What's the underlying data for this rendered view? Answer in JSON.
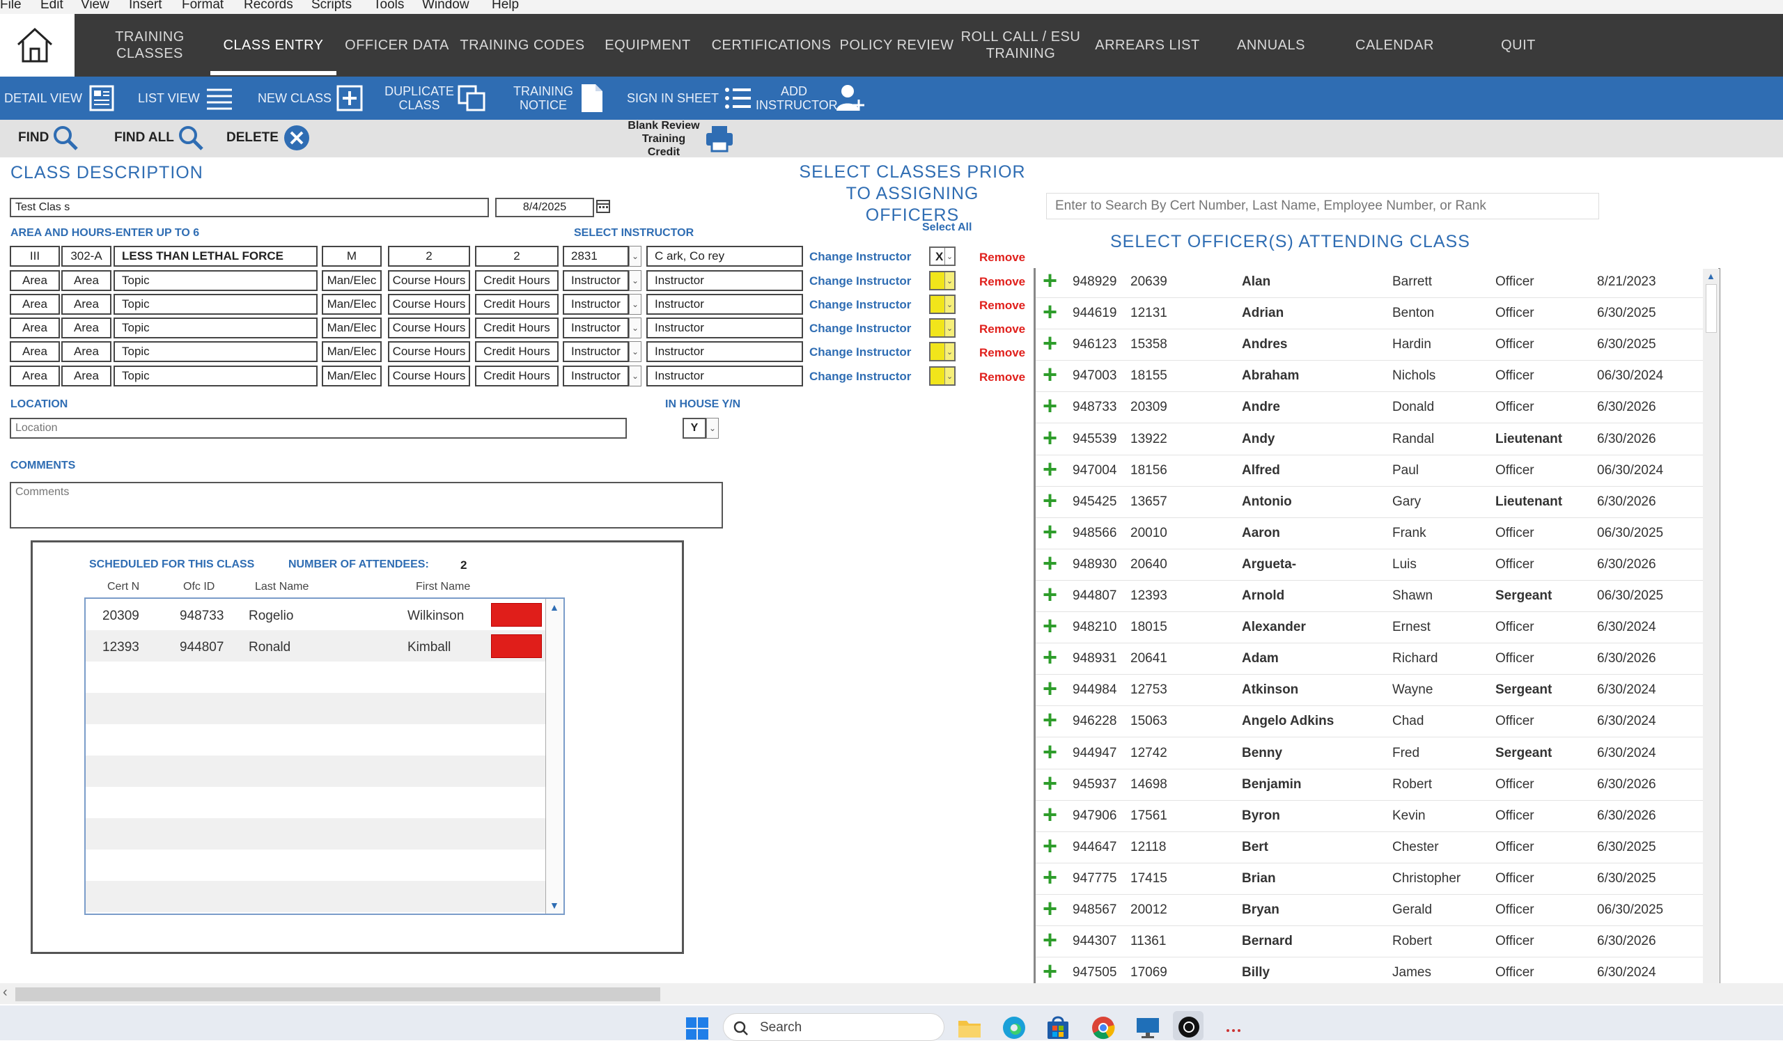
{
  "menu": [
    "File",
    "Edit",
    "View",
    "Insert",
    "Format",
    "Records",
    "Scripts",
    "Tools",
    "Window",
    "Help"
  ],
  "nav": {
    "training_classes": "TRAINING CLASSES",
    "class_entry": "CLASS ENTRY",
    "officer_data": "OFFICER DATA",
    "training_codes": "TRAINING CODES",
    "equipment": "EQUIPMENT",
    "certifications": "CERTIFICATIONS",
    "policy_review": "POLICY REVIEW",
    "roll_call": "ROLL CALL / ESU TRAINING",
    "arrears_list": "ARREARS LIST",
    "annuals": "ANNUALS",
    "calendar": "CALENDAR",
    "quit": "QUIT"
  },
  "toolbar": {
    "detail_view": "DETAIL VIEW",
    "list_view": "LIST VIEW",
    "new_class": "NEW CLASS",
    "duplicate_class": "DUPLICATE CLASS",
    "training_notice": "TRAINING NOTICE",
    "sign_in_sheet": "SIGN IN SHEET",
    "add_instructor": "ADD INSTRUCTOR"
  },
  "actions": {
    "find": "FIND",
    "find_all": "FIND ALL",
    "delete": "DELETE",
    "blank_review": "Blank Review Training Credit"
  },
  "class": {
    "section_title": "CLASS DESCRIPTION",
    "name": "Test Clas s",
    "date": "8/4/2025",
    "area_label": "AREA AND HOURS-ENTER UP TO 6",
    "select_instructor_label": "SELECT INSTRUCTOR",
    "select_all": "Select All",
    "rows": [
      {
        "a1": "III",
        "a2": "302-A",
        "topic": "LESS THAN LETHAL FORCE",
        "man": "M",
        "course": "2",
        "credit": "2",
        "instr": "2831",
        "name": "C ark, Co rey",
        "change": "Change Instructor",
        "sel": "X",
        "remove": "Remove"
      },
      {
        "a1": "Area",
        "a2": "Area",
        "topic": "Topic",
        "man": "Man/Elec",
        "course": "Course Hours",
        "credit": "Credit Hours",
        "instr": "Instructor",
        "name": "Instructor",
        "change": "Change Instructor",
        "sel": "",
        "remove": "Remove"
      },
      {
        "a1": "Area",
        "a2": "Area",
        "topic": "Topic",
        "man": "Man/Elec",
        "course": "Course Hours",
        "credit": "Credit Hours",
        "instr": "Instructor",
        "name": "Instructor",
        "change": "Change Instructor",
        "sel": "",
        "remove": "Remove"
      },
      {
        "a1": "Area",
        "a2": "Area",
        "topic": "Topic",
        "man": "Man/Elec",
        "course": "Course Hours",
        "credit": "Credit Hours",
        "instr": "Instructor",
        "name": "Instructor",
        "change": "Change Instructor",
        "sel": "",
        "remove": "Remove"
      },
      {
        "a1": "Area",
        "a2": "Area",
        "topic": "Topic",
        "man": "Man/Elec",
        "course": "Course Hours",
        "credit": "Credit Hours",
        "instr": "Instructor",
        "name": "Instructor",
        "change": "Change Instructor",
        "sel": "",
        "remove": "Remove"
      },
      {
        "a1": "Area",
        "a2": "Area",
        "topic": "Topic",
        "man": "Man/Elec",
        "course": "Course Hours",
        "credit": "Credit Hours",
        "instr": "Instructor",
        "name": "Instructor",
        "change": "Change Instructor",
        "sel": "",
        "remove": "Remove"
      }
    ],
    "location_label": "LOCATION",
    "location_placeholder": "Location",
    "in_house_label": "IN HOUSE Y/N",
    "in_house_value": "Y",
    "comments_label": "COMMENTS",
    "comments_placeholder": "Comments"
  },
  "attendees": {
    "scheduled_label": "SCHEDULED FOR THIS CLASS",
    "number_label": "NUMBER OF ATTENDEES:",
    "count": "2",
    "headers": {
      "cert": "Cert N",
      "ofc": "Ofc ID",
      "last": "Last Name",
      "first": "First Name"
    },
    "rows": [
      {
        "cert": "20309",
        "ofc": "948733",
        "last": "Rogelio",
        "first": "Wilkinson"
      },
      {
        "cert": "12393",
        "ofc": "944807",
        "last": "Ronald",
        "first": "Kimball"
      }
    ]
  },
  "officers": {
    "prior_title_1": "SELECT CLASSES PRIOR",
    "prior_title_2": "TO ASSIGNING OFFICERS",
    "search_placeholder": "Enter to Search By Cert Number, Last Name, Employee Number, or Rank",
    "list_title": "SELECT OFFICER(S) ATTENDING CLASS",
    "rows": [
      {
        "ofc": "948929",
        "cert": "20639",
        "first": "Alan",
        "last": "Barrett",
        "rank": "Officer",
        "date": "8/21/2023"
      },
      {
        "ofc": "944619",
        "cert": "12131",
        "first": "Adrian",
        "last": "Benton",
        "rank": "Officer",
        "date": "6/30/2025"
      },
      {
        "ofc": "946123",
        "cert": "15358",
        "first": "Andres",
        "last": "Hardin",
        "rank": "Officer",
        "date": "6/30/2025"
      },
      {
        "ofc": "947003",
        "cert": "18155",
        "first": "Abraham",
        "last": "Nichols",
        "rank": "Officer",
        "date": "06/30/2024"
      },
      {
        "ofc": "948733",
        "cert": "20309",
        "first": "Andre",
        "last": "Donald",
        "rank": "Officer",
        "date": "6/30/2026"
      },
      {
        "ofc": "945539",
        "cert": "13922",
        "first": "Andy",
        "last": "Randal",
        "rank": "Lieutenant",
        "date": "6/30/2026"
      },
      {
        "ofc": "947004",
        "cert": "18156",
        "first": "Alfred",
        "last": "Paul",
        "rank": "Officer",
        "date": "06/30/2024"
      },
      {
        "ofc": "945425",
        "cert": "13657",
        "first": "Antonio",
        "last": "Gary",
        "rank": "Lieutenant",
        "date": "6/30/2026"
      },
      {
        "ofc": "948566",
        "cert": "20010",
        "first": "Aaron",
        "last": "Frank",
        "rank": "Officer",
        "date": "06/30/2025"
      },
      {
        "ofc": "948930",
        "cert": "20640",
        "first": "Argueta-",
        "last": "Luis",
        "rank": "Officer",
        "date": "6/30/2026"
      },
      {
        "ofc": "944807",
        "cert": "12393",
        "first": "Arnold",
        "last": "Shawn",
        "rank": "Sergeant",
        "date": "06/30/2025"
      },
      {
        "ofc": "948210",
        "cert": "18015",
        "first": "Alexander",
        "last": "Ernest",
        "rank": "Officer",
        "date": "6/30/2024"
      },
      {
        "ofc": "948931",
        "cert": "20641",
        "first": "Adam",
        "last": "Richard",
        "rank": "Officer",
        "date": "6/30/2026"
      },
      {
        "ofc": "944984",
        "cert": "12753",
        "first": "Atkinson",
        "last": "Wayne",
        "rank": "Sergeant",
        "date": "6/30/2024"
      },
      {
        "ofc": "946228",
        "cert": "15063",
        "first": "Angelo Adkins",
        "last": "Chad",
        "rank": "Officer",
        "date": "6/30/2024"
      },
      {
        "ofc": "944947",
        "cert": "12742",
        "first": "Benny",
        "last": "Fred",
        "rank": "Sergeant",
        "date": "6/30/2024"
      },
      {
        "ofc": "945937",
        "cert": "14698",
        "first": "Benjamin",
        "last": "Robert",
        "rank": "Officer",
        "date": "6/30/2026"
      },
      {
        "ofc": "947906",
        "cert": "17561",
        "first": "Byron",
        "last": "Kevin",
        "rank": "Officer",
        "date": "6/30/2026"
      },
      {
        "ofc": "944647",
        "cert": "12118",
        "first": "Bert",
        "last": "Chester",
        "rank": "Officer",
        "date": "6/30/2025"
      },
      {
        "ofc": "947775",
        "cert": "17415",
        "first": "Brian",
        "last": "Christopher",
        "rank": "Officer",
        "date": "6/30/2025"
      },
      {
        "ofc": "948567",
        "cert": "20012",
        "first": "Bryan",
        "last": "Gerald",
        "rank": "Officer",
        "date": "06/30/2025"
      },
      {
        "ofc": "944307",
        "cert": "11361",
        "first": "Bernard",
        "last": "Robert",
        "rank": "Officer",
        "date": "6/30/2026"
      },
      {
        "ofc": "947505",
        "cert": "17069",
        "first": "Billy",
        "last": "James",
        "rank": "Officer",
        "date": "6/30/2024"
      }
    ]
  },
  "taskbar": {
    "search_placeholder": "Search"
  }
}
